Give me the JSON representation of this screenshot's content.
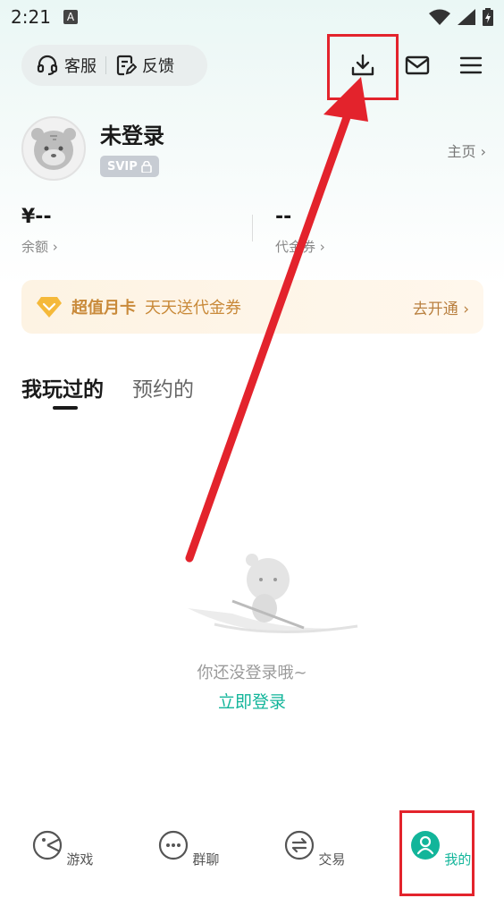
{
  "status_bar": {
    "time": "2:21",
    "badge": "A"
  },
  "header": {
    "service_label": "客服",
    "feedback_label": "反馈"
  },
  "profile": {
    "username": "未登录",
    "vip_badge": "SVIP",
    "home_link": "主页"
  },
  "stats": {
    "balance_value": "¥--",
    "balance_label": "余额",
    "voucher_value": "--",
    "voucher_label": "代金券"
  },
  "vip_banner": {
    "title": "超值月卡",
    "subtitle": "天天送代金券",
    "cta": "去开通"
  },
  "tabs": [
    {
      "label": "我玩过的",
      "active": true
    },
    {
      "label": "预约的",
      "active": false
    }
  ],
  "empty_state": {
    "message": "你还没登录哦~",
    "login_link": "立即登录"
  },
  "bottom_nav": [
    {
      "label": "游戏",
      "icon": "pacman-icon"
    },
    {
      "label": "群聊",
      "icon": "chat-dots-icon"
    },
    {
      "label": "交易",
      "icon": "swap-icon"
    },
    {
      "label": "我的",
      "icon": "user-icon",
      "active": true
    }
  ],
  "colors": {
    "accent": "#12b59a",
    "highlight": "#e3232c",
    "vip": "#c98a3a"
  }
}
